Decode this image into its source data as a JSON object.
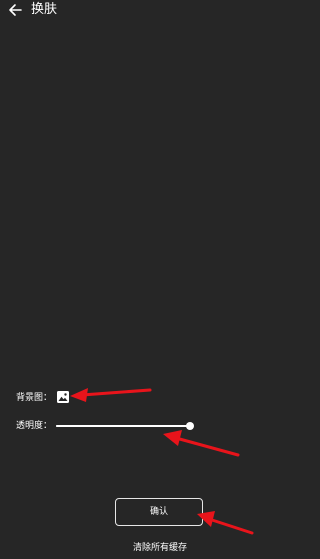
{
  "header": {
    "title": "换肤",
    "back_icon": "arrow-left-icon"
  },
  "settings": {
    "background_label": "背景图：",
    "background_icon": "image-icon",
    "opacity_label": "透明度：",
    "opacity_value": 1.0
  },
  "actions": {
    "confirm_label": "确认",
    "clear_cache_label": "清除所有缓存"
  },
  "colors": {
    "background": "#262626",
    "foreground": "#ffffff",
    "annotation_arrow": "#e8141b"
  }
}
